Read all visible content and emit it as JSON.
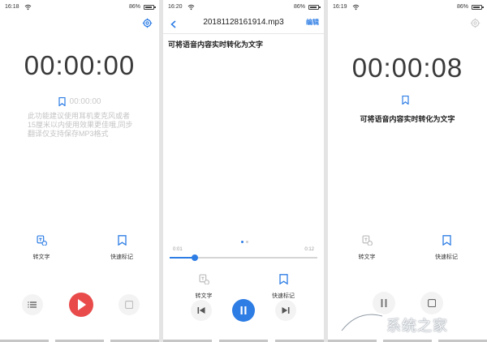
{
  "colors": {
    "accent": "#2d7de5",
    "record": "#e94b4b",
    "muted_text": "#c4c4c4",
    "button_bg": "#f3f3f3"
  },
  "screen1": {
    "status": {
      "time": "16:18",
      "battery": "86%"
    },
    "timer": "00:00:00",
    "flag_time": "00:00:00",
    "hint": "此功能建议使用耳机麦克风或者15厘米以内使用效果更佳哦,同步翻译仅支持保存MP3格式",
    "transcribe_label": "转文字",
    "quick_mark_label": "快速标记",
    "icons": [
      "settings-icon",
      "flag-icon",
      "transcribe-icon",
      "bookmark-icon",
      "list-icon",
      "record-icon",
      "stop-icon"
    ]
  },
  "screen2": {
    "status": {
      "time": "16:20",
      "battery": "86%"
    },
    "file_name": "20181128161914.mp3",
    "edit_label": "编辑",
    "transcript": "可将语音内容实时转化为文字",
    "current_time": "0:01",
    "total_time": "0:12",
    "progress": 0.17,
    "page_dots": 2,
    "page_active": 0,
    "transcribe_label": "转文字",
    "quick_mark_label": "快速标记"
  },
  "screen3": {
    "status": {
      "time": "16:19",
      "battery": "86%"
    },
    "timer": "00:00:08",
    "transcript": "可将语音内容实时转化为文字",
    "transcribe_label": "转文字",
    "quick_mark_label": "快速标记"
  },
  "watermark": {
    "text": "系统之家"
  }
}
